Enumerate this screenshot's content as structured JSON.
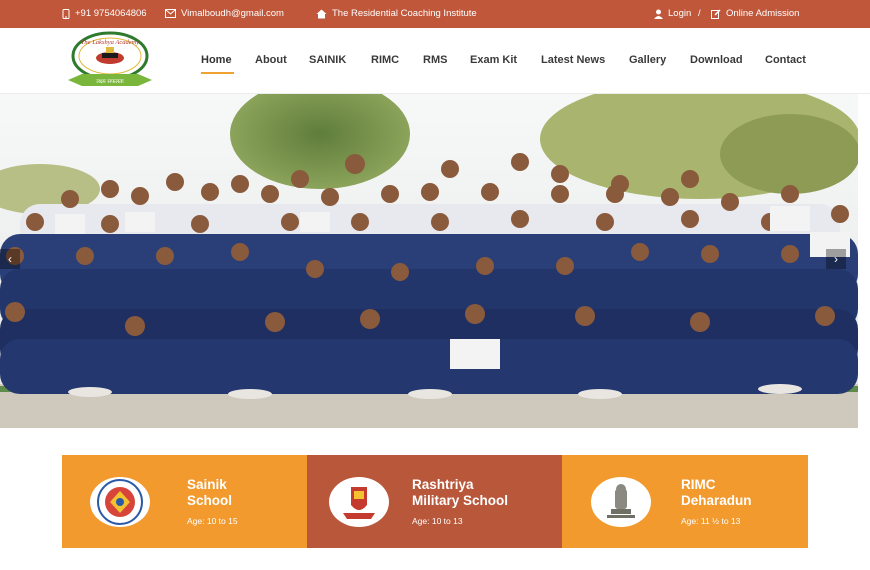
{
  "topbar": {
    "phone": "+91 9754064806",
    "email": "Vimalboudh@gmail.com",
    "tagline": "The Residential Coaching Institute",
    "login": "Login",
    "separator": "/",
    "admission": "Online Admission"
  },
  "logo": {
    "top_text": "The Lakshya Academy",
    "banner_text": "लक्ष्य सफलता"
  },
  "nav": {
    "items": [
      "Home",
      "About",
      "SAINIK",
      "RIMC",
      "RMS",
      "Exam Kit",
      "Latest News",
      "Gallery",
      "Download",
      "Contact"
    ]
  },
  "hero": {
    "prev": "‹",
    "next": "›"
  },
  "cards": [
    {
      "title1": "Sainik",
      "title2": "School",
      "age": "Age: 10 to 15",
      "color": "#f29a2e"
    },
    {
      "title1": "Rashtriya",
      "title2": "Military School",
      "age": "Age: 10 to 13",
      "color": "#b8573a"
    },
    {
      "title1": "RIMC",
      "title2": "Deharadun",
      "age": "Age: 11 ½ to 13",
      "color": "#f29a2e"
    }
  ],
  "colors": {
    "topbar": "#c0573a",
    "accent": "#f0a233",
    "card_orange": "#f29a2e",
    "card_rust": "#b8573a"
  }
}
